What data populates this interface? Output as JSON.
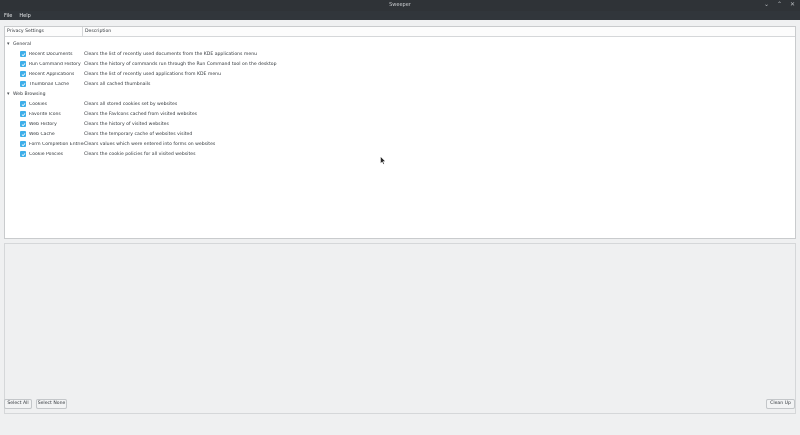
{
  "window": {
    "title": "Sweeper"
  },
  "menubar": {
    "items": [
      "File",
      "Help"
    ]
  },
  "tree": {
    "headers": {
      "name": "Privacy Settings",
      "description": "Description"
    },
    "groups": [
      {
        "label": "General",
        "items": [
          {
            "label": "Recent Documents",
            "checked": true,
            "description": "Clears the list of recently used documents from the KDE applications menu"
          },
          {
            "label": "Run Command History",
            "checked": true,
            "description": "Clears the history of commands run through the Run Command tool on the desktop"
          },
          {
            "label": "Recent Applications",
            "checked": true,
            "description": "Clears the list of recently used applications from KDE menu"
          },
          {
            "label": "Thumbnail Cache",
            "checked": true,
            "description": "Clears all cached thumbnails"
          }
        ]
      },
      {
        "label": "Web Browsing",
        "items": [
          {
            "label": "Cookies",
            "checked": true,
            "description": "Clears all stored cookies set by websites"
          },
          {
            "label": "Favorite Icons",
            "checked": true,
            "description": "Clears the FavIcons cached from visited websites"
          },
          {
            "label": "Web History",
            "checked": true,
            "description": "Clears the history of visited websites"
          },
          {
            "label": "Web Cache",
            "checked": true,
            "description": "Clears the temporary cache of websites visited"
          },
          {
            "label": "Form Completion Entries",
            "checked": true,
            "description": "Clears values which were entered into forms on websites"
          },
          {
            "label": "Cookie Policies",
            "checked": true,
            "description": "Clears the cookie policies for all visited websites"
          }
        ]
      }
    ]
  },
  "buttons": {
    "select_all": "Select All",
    "select_none": "Select None",
    "clean_up": "Clean Up"
  },
  "colors": {
    "accent": "#3daee9",
    "titlebar": "#2f3337",
    "menubar": "#31363b",
    "window_bg": "#eff0f1"
  }
}
